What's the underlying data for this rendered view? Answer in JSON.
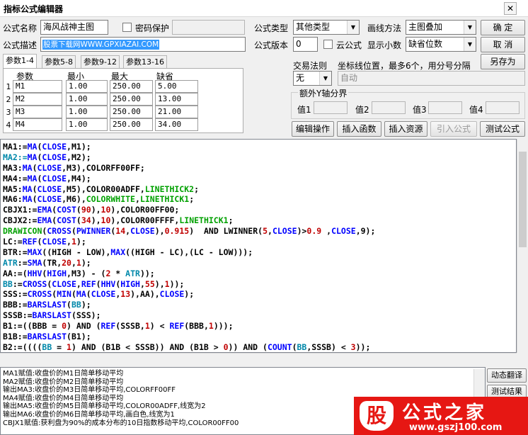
{
  "window": {
    "title": "指标公式编辑器",
    "close_glyph": "✕"
  },
  "form": {
    "name_label": "公式名称",
    "name_value": "海风战神主图",
    "password_label": "密码保护",
    "password_value": "",
    "desc_label": "公式描述",
    "desc_value": "股票下载网WWW.GPXIAZAI.COM",
    "type_label": "公式类型",
    "type_value": "其他类型",
    "draw_label": "画线方法",
    "draw_value": "主图叠加",
    "version_label": "公式版本",
    "version_value": "0",
    "cloud_label": "云公式",
    "decimal_label": "显示小数",
    "decimal_value": "缺省位数"
  },
  "buttons": {
    "ok": "确 定",
    "cancel": "取 消",
    "save_as": "另存为",
    "edit_ops": "编辑操作",
    "insert_func": "插入函数",
    "insert_res": "插入资源",
    "import_formula": "引入公式",
    "test_formula": "测试公式",
    "dynamic_translate": "动态翻译",
    "test_result": "测试结果"
  },
  "tabs": [
    "参数1-4",
    "参数5-8",
    "参数9-12",
    "参数13-16"
  ],
  "params": {
    "headers": [
      "参数",
      "最小",
      "最大",
      "缺省"
    ],
    "rows": [
      {
        "n": "1",
        "name": "M1",
        "min": "1.00",
        "max": "250.00",
        "def": "5.00"
      },
      {
        "n": "2",
        "name": "M2",
        "min": "1.00",
        "max": "250.00",
        "def": "13.00"
      },
      {
        "n": "3",
        "name": "M3",
        "min": "1.00",
        "max": "250.00",
        "def": "21.00"
      },
      {
        "n": "4",
        "name": "M4",
        "min": "1.00",
        "max": "250.00",
        "def": "34.00"
      }
    ]
  },
  "trade": {
    "rule_label": "交易法则",
    "rule_value": "无",
    "coord_label": "坐标线位置，最多6个，用分号分隔",
    "coord_value": "自动",
    "extra_label": "额外Y轴分界",
    "v1": "值1",
    "v2": "值2",
    "v3": "值3",
    "v4": "值4"
  },
  "colors": {
    "blue": "#0000ff",
    "teal": "#0088aa",
    "green": "#00a000",
    "red": "#c00000",
    "black": "#000000"
  },
  "code_lines": [
    [
      [
        "MA1:=",
        "k"
      ],
      [
        "MA",
        "b"
      ],
      [
        "(",
        "k"
      ],
      [
        "CLOSE",
        "b"
      ],
      [
        ",M1);",
        "k"
      ]
    ],
    [
      [
        "MA2:=",
        "t"
      ],
      [
        "MA",
        "b"
      ],
      [
        "(",
        "k"
      ],
      [
        "CLOSE",
        "b"
      ],
      [
        ",M2);",
        "k"
      ]
    ],
    [
      [
        "MA3:",
        "k"
      ],
      [
        "MA",
        "b"
      ],
      [
        "(",
        "k"
      ],
      [
        "CLOSE",
        "b"
      ],
      [
        ",M3),COLORFF00FF;",
        "k"
      ]
    ],
    [
      [
        "MA4:=",
        "k"
      ],
      [
        "MA",
        "b"
      ],
      [
        "(",
        "k"
      ],
      [
        "CLOSE",
        "b"
      ],
      [
        ",M4);",
        "k"
      ]
    ],
    [
      [
        "MA5:",
        "k"
      ],
      [
        "MA",
        "b"
      ],
      [
        "(",
        "k"
      ],
      [
        "CLOSE",
        "b"
      ],
      [
        ",M5),COLOR00ADFF,",
        "k"
      ],
      [
        "LINETHICK2",
        "g"
      ],
      [
        ";",
        "k"
      ]
    ],
    [
      [
        "MA6:",
        "k"
      ],
      [
        "MA",
        "b"
      ],
      [
        "(",
        "k"
      ],
      [
        "CLOSE",
        "b"
      ],
      [
        ",M6),",
        "k"
      ],
      [
        "COLORWHITE",
        "g"
      ],
      [
        ",",
        "k"
      ],
      [
        "LINETHICK1",
        "g"
      ],
      [
        ";",
        "k"
      ]
    ],
    [
      [
        "CBJX1:=",
        "k"
      ],
      [
        "EMA",
        "b"
      ],
      [
        "(",
        "k"
      ],
      [
        "COST",
        "b"
      ],
      [
        "(",
        "k"
      ],
      [
        "90",
        "r"
      ],
      [
        "),",
        "k"
      ],
      [
        "10",
        "r"
      ],
      [
        "),COLOR00FF00;",
        "k"
      ]
    ],
    [
      [
        "CBJX2:=",
        "k"
      ],
      [
        "EMA",
        "b"
      ],
      [
        "(",
        "k"
      ],
      [
        "COST",
        "b"
      ],
      [
        "(",
        "k"
      ],
      [
        "34",
        "r"
      ],
      [
        "),",
        "k"
      ],
      [
        "10",
        "r"
      ],
      [
        "),COLOR00FFFF,",
        "k"
      ],
      [
        "LINETHICK1",
        "g"
      ],
      [
        ";",
        "k"
      ]
    ],
    [
      [
        "DRAWICON",
        "g"
      ],
      [
        "(",
        "k"
      ],
      [
        "CROSS",
        "b"
      ],
      [
        "(",
        "k"
      ],
      [
        "PWINNER",
        "b"
      ],
      [
        "(",
        "k"
      ],
      [
        "14",
        "r"
      ],
      [
        ",",
        "k"
      ],
      [
        "CLOSE",
        "b"
      ],
      [
        "),",
        "k"
      ],
      [
        "0.915",
        "r"
      ],
      [
        ")  AND LWINNER(",
        "k"
      ],
      [
        "5",
        "r"
      ],
      [
        ",",
        "k"
      ],
      [
        "CLOSE",
        "b"
      ],
      [
        ")>",
        "k"
      ],
      [
        "0.9",
        "r"
      ],
      [
        " ,",
        "k"
      ],
      [
        "CLOSE",
        "b"
      ],
      [
        ",9);",
        "k"
      ]
    ],
    [
      [
        "LC:=",
        "k"
      ],
      [
        "REF",
        "b"
      ],
      [
        "(",
        "k"
      ],
      [
        "CLOSE",
        "b"
      ],
      [
        ",",
        "k"
      ],
      [
        "1",
        "r"
      ],
      [
        ");",
        "k"
      ]
    ],
    [
      [
        "BTR:=",
        "k"
      ],
      [
        "MAX",
        "b"
      ],
      [
        "((HIGH - LOW),",
        "k"
      ],
      [
        "MAX",
        "b"
      ],
      [
        "((HIGH - LC),(LC - LOW)));",
        "k"
      ]
    ],
    [
      [
        "ATR",
        "t"
      ],
      [
        ":=",
        "k"
      ],
      [
        "SMA",
        "b"
      ],
      [
        "(TR,",
        "k"
      ],
      [
        "20",
        "r"
      ],
      [
        ",",
        "k"
      ],
      [
        "1",
        "r"
      ],
      [
        ");",
        "k"
      ]
    ],
    [
      [
        "AA:=(",
        "k"
      ],
      [
        "HHV",
        "b"
      ],
      [
        "(",
        "k"
      ],
      [
        "HIGH",
        "b"
      ],
      [
        ",M3) - (",
        "k"
      ],
      [
        "2",
        "r"
      ],
      [
        " * ",
        "k"
      ],
      [
        "ATR",
        "t"
      ],
      [
        "));",
        "k"
      ]
    ],
    [
      [
        "BB",
        "t"
      ],
      [
        ":=",
        "k"
      ],
      [
        "CROSS",
        "b"
      ],
      [
        "(",
        "k"
      ],
      [
        "CLOSE",
        "b"
      ],
      [
        ",",
        "k"
      ],
      [
        "REF",
        "b"
      ],
      [
        "(",
        "k"
      ],
      [
        "HHV",
        "b"
      ],
      [
        "(",
        "k"
      ],
      [
        "HIGH",
        "b"
      ],
      [
        ",",
        "k"
      ],
      [
        "55",
        "r"
      ],
      [
        "),",
        "k"
      ],
      [
        "1",
        "r"
      ],
      [
        "));",
        "k"
      ]
    ],
    [
      [
        "SSS:=",
        "k"
      ],
      [
        "CROSS",
        "b"
      ],
      [
        "(",
        "k"
      ],
      [
        "MIN",
        "b"
      ],
      [
        "(",
        "k"
      ],
      [
        "MA",
        "b"
      ],
      [
        "(",
        "k"
      ],
      [
        "CLOSE",
        "b"
      ],
      [
        ",",
        "k"
      ],
      [
        "13",
        "r"
      ],
      [
        "),AA),",
        "k"
      ],
      [
        "CLOSE",
        "b"
      ],
      [
        ");",
        "k"
      ]
    ],
    [
      [
        "BBB:=",
        "k"
      ],
      [
        "BARSLAST",
        "b"
      ],
      [
        "(",
        "k"
      ],
      [
        "BB",
        "t"
      ],
      [
        ");",
        "k"
      ]
    ],
    [
      [
        "SSSB:=",
        "k"
      ],
      [
        "BARSLAST",
        "b"
      ],
      [
        "(SSS);",
        "k"
      ]
    ],
    [
      [
        "B1:=((BBB = ",
        "k"
      ],
      [
        "0",
        "r"
      ],
      [
        ") AND (",
        "k"
      ],
      [
        "REF",
        "b"
      ],
      [
        "(SSSB,",
        "k"
      ],
      [
        "1",
        "r"
      ],
      [
        ") < ",
        "k"
      ],
      [
        "REF",
        "b"
      ],
      [
        "(BBB,",
        "k"
      ],
      [
        "1",
        "r"
      ],
      [
        ")));",
        "k"
      ]
    ],
    [
      [
        "B1B:=",
        "k"
      ],
      [
        "BARSLAST",
        "b"
      ],
      [
        "(B1);",
        "k"
      ]
    ],
    [
      [
        "B2:=((((",
        "k"
      ],
      [
        "BB",
        "t"
      ],
      [
        " = ",
        "k"
      ],
      [
        "1",
        "r"
      ],
      [
        ") AND (B1B < SSSB)) AND (B1B > ",
        "k"
      ],
      [
        "0",
        "r"
      ],
      [
        ")) AND (",
        "k"
      ],
      [
        "COUNT",
        "b"
      ],
      [
        "(",
        "k"
      ],
      [
        "BB",
        "t"
      ],
      [
        ",SSSB) < ",
        "k"
      ],
      [
        "3",
        "r"
      ],
      [
        "));",
        "k"
      ]
    ]
  ],
  "output_lines": [
    "MA1赋值:收盘价的M1日简单移动平均",
    "MA2赋值:收盘价的M2日简单移动平均",
    "输出MA3:收盘价的M3日简单移动平均,COLORFF00FF",
    "MA4赋值:收盘价的M4日简单移动平均",
    "输出MA5:收盘价的M5日简单移动平均,COLOR00ADFF,线宽为2",
    "输出MA6:收盘价的M6日简单移动平均,画白色,线宽为1",
    "CBJX1赋值:获利盘为90%的成本分布的10日指数移动平均,COLOR00FF00"
  ],
  "logo": {
    "char": "股",
    "text": "公式之家",
    "url": "www.gszj100.com"
  }
}
